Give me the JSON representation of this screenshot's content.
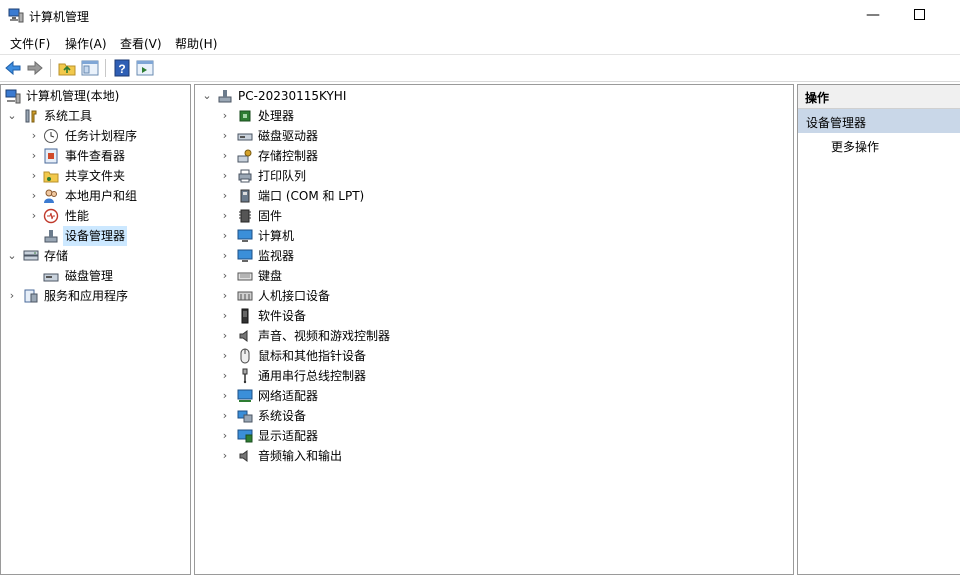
{
  "window": {
    "title": "计算机管理",
    "minimize_icon": "minimize-icon",
    "maximize_icon": "maximize-icon"
  },
  "menu": {
    "items": [
      "文件(F)",
      "操作(A)",
      "查看(V)",
      "帮助(H)"
    ]
  },
  "toolbar": {
    "icons": [
      "back-arrow-icon",
      "forward-arrow-icon",
      "up-folder-icon",
      "show-hide-tree-icon",
      "help-icon",
      "show-hide-action-pane-icon"
    ]
  },
  "left_tree": {
    "root": "计算机管理(本地)",
    "system_tools": "系统工具",
    "task_scheduler": "任务计划程序",
    "event_viewer": "事件查看器",
    "shared_folders": "共享文件夹",
    "local_users": "本地用户和组",
    "performance": "性能",
    "device_manager": "设备管理器",
    "storage": "存储",
    "disk_management": "磁盘管理",
    "services_apps": "服务和应用程序"
  },
  "device_tree": {
    "computer_name": "PC-20230115KYHI",
    "categories": [
      {
        "label": "处理器",
        "icon": "processor-icon"
      },
      {
        "label": "磁盘驱动器",
        "icon": "disk-drive-icon"
      },
      {
        "label": "存储控制器",
        "icon": "storage-controller-icon"
      },
      {
        "label": "打印队列",
        "icon": "printer-icon"
      },
      {
        "label": "端口 (COM 和 LPT)",
        "icon": "port-icon"
      },
      {
        "label": "固件",
        "icon": "firmware-icon"
      },
      {
        "label": "计算机",
        "icon": "computer-icon"
      },
      {
        "label": "监视器",
        "icon": "monitor-icon"
      },
      {
        "label": "键盘",
        "icon": "keyboard-icon"
      },
      {
        "label": "人机接口设备",
        "icon": "hid-icon"
      },
      {
        "label": "软件设备",
        "icon": "software-device-icon"
      },
      {
        "label": "声音、视频和游戏控制器",
        "icon": "speaker-icon"
      },
      {
        "label": "鼠标和其他指针设备",
        "icon": "mouse-icon"
      },
      {
        "label": "通用串行总线控制器",
        "icon": "usb-icon"
      },
      {
        "label": "网络适配器",
        "icon": "network-adapter-icon"
      },
      {
        "label": "系统设备",
        "icon": "system-device-icon"
      },
      {
        "label": "显示适配器",
        "icon": "display-adapter-icon"
      },
      {
        "label": "音频输入和输出",
        "icon": "audio-io-icon"
      }
    ]
  },
  "actions_pane": {
    "header": "操作",
    "section": "设备管理器",
    "more_actions": "更多操作"
  },
  "colors": {
    "selection": "#cce8ff",
    "section_band": "#c9d7e8",
    "header_band": "#f0f0f0"
  }
}
